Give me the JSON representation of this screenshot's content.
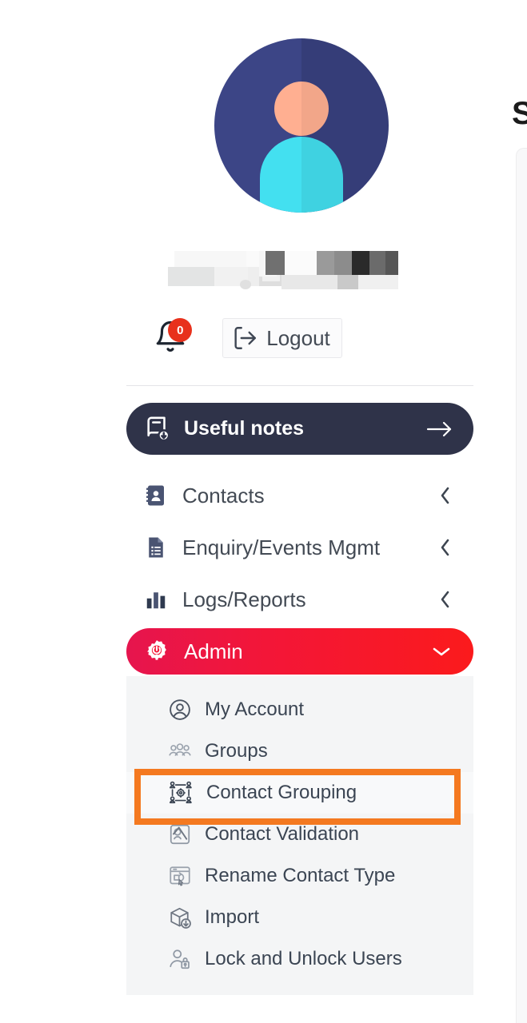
{
  "app": {
    "background_color": "#ffffff",
    "sidebar_background": "#ffffff",
    "submenu_background": "#f4f5f6",
    "accent_dark": "#2f3349",
    "accent_red_start": "#e6154e",
    "accent_red_end": "#fb1a1c",
    "highlight_color": "#f47920",
    "text_color": "#434a54"
  },
  "profile": {
    "avatar_icon": "user-avatar-icon",
    "avatar_circle_color": "#3c4586",
    "avatar_head_color": "#ffaf91",
    "avatar_body_color": "#43e0f0",
    "user_name": "",
    "user_name_state": "redacted"
  },
  "actions": {
    "notifications": {
      "icon": "bell-icon",
      "badge_count": "0",
      "badge_color": "#e8311c"
    },
    "logout": {
      "icon": "logout-icon",
      "label": "Logout"
    }
  },
  "notes_banner": {
    "icon": "book-add-icon",
    "label": "Useful notes",
    "arrow_icon": "arrow-right-icon"
  },
  "nav": {
    "items": [
      {
        "label": "Contacts",
        "icon": "address-book-icon",
        "chevron": "chevron-left-icon",
        "expanded": false
      },
      {
        "label": "Enquiry/Events Mgmt",
        "icon": "document-list-icon",
        "chevron": "chevron-left-icon",
        "expanded": false
      },
      {
        "label": "Logs/Reports",
        "icon": "bar-chart-icon",
        "chevron": "chevron-left-icon",
        "expanded": false
      }
    ],
    "active": {
      "label": "Admin",
      "icon": "gear-power-icon",
      "chevron": "chevron-down-icon",
      "expanded": true
    }
  },
  "submenu": {
    "items": [
      {
        "label": "My Account",
        "icon": "user-circle-icon",
        "highlighted": false
      },
      {
        "label": "Groups",
        "icon": "users-group-icon",
        "highlighted": false
      },
      {
        "label": "Contact Grouping",
        "icon": "contact-grouping-icon",
        "highlighted": true
      },
      {
        "label": "Contact Validation",
        "icon": "contact-validation-icon",
        "highlighted": false
      },
      {
        "label": "Rename Contact Type",
        "icon": "rename-window-icon",
        "highlighted": false
      },
      {
        "label": "Import",
        "icon": "import-box-icon",
        "highlighted": false
      },
      {
        "label": "Lock and Unlock Users",
        "icon": "user-lock-icon",
        "highlighted": false
      }
    ]
  },
  "content": {
    "partial_heading": "S"
  }
}
